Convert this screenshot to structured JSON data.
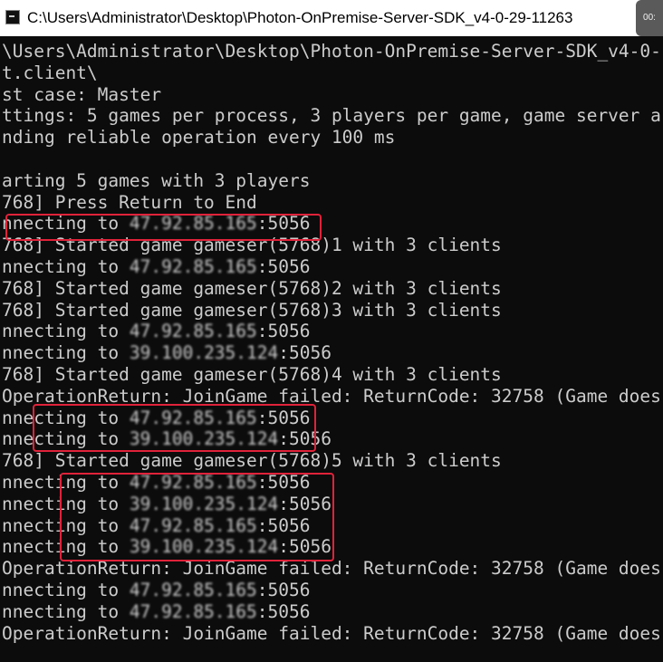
{
  "window": {
    "title": "C:\\Users\\Administrator\\Desktop\\Photon-OnPremise-Server-SDK_v4-0-29-11263",
    "overlay_badge": "00:"
  },
  "console": {
    "lines": [
      {
        "text": "\\Users\\Administrator\\Desktop\\Photon-OnPremise-Server-SDK_v4-0-"
      },
      {
        "text": "t.client\\"
      },
      {
        "text": "st case: Master"
      },
      {
        "text": "ttings: 5 games per process, 3 players per game, game server a"
      },
      {
        "text": "nding reliable operation every 100 ms"
      },
      {
        "text": ""
      },
      {
        "text": "arting 5 games with 3 players"
      },
      {
        "text": "768] Press Return to End"
      },
      {
        "prefix": "nnecting to ",
        "ip": "47.92.85.165",
        "suffix": ":5056"
      },
      {
        "text": "768] Started game gameser(5768)1 with 3 clients"
      },
      {
        "prefix": "nnecting to ",
        "ip": "47.92.85.165",
        "suffix": ":5056"
      },
      {
        "text": "768] Started game gameser(5768)2 with 3 clients"
      },
      {
        "text": "768] Started game gameser(5768)3 with 3 clients"
      },
      {
        "prefix": "nnecting to ",
        "ip": "47.92.85.165",
        "suffix": ":5056"
      },
      {
        "prefix": "nnecting to ",
        "ip": "39.100.235.124",
        "suffix": ":5056"
      },
      {
        "text": "768] Started game gameser(5768)4 with 3 clients"
      },
      {
        "text": "OperationReturn: JoinGame failed: ReturnCode: 32758 (Game does"
      },
      {
        "prefix": "nnecting to ",
        "ip": "47.92.85.165",
        "suffix": ":5056"
      },
      {
        "prefix": "nnecting to ",
        "ip": "39.100.235.124",
        "suffix": ":5056"
      },
      {
        "text": "768] Started game gameser(5768)5 with 3 clients"
      },
      {
        "prefix": "nnecting to ",
        "ip": "47.92.85.165",
        "suffix": ":5056"
      },
      {
        "prefix": "nnecting to ",
        "ip": "39.100.235.124",
        "suffix": ":5056"
      },
      {
        "prefix": "nnecting to ",
        "ip": "47.92.85.165",
        "suffix": ":5056"
      },
      {
        "prefix": "nnecting to ",
        "ip": "39.100.235.124",
        "suffix": ":5056"
      },
      {
        "text": "OperationReturn: JoinGame failed: ReturnCode: 32758 (Game does"
      },
      {
        "prefix": "nnecting to ",
        "ip": "47.92.85.165",
        "suffix": ":5056"
      },
      {
        "prefix": "nnecting to ",
        "ip": "47.92.85.165",
        "suffix": ":5056"
      },
      {
        "text": "OperationReturn: JoinGame failed: ReturnCode: 32758 (Game does"
      }
    ]
  },
  "colors": {
    "console_background": "#0c0c0c",
    "console_text": "#cccccc",
    "annotation_box": "#e0223a",
    "titlebar_background": "#ffffff"
  },
  "icons": {
    "app_icon": "console-icon"
  }
}
